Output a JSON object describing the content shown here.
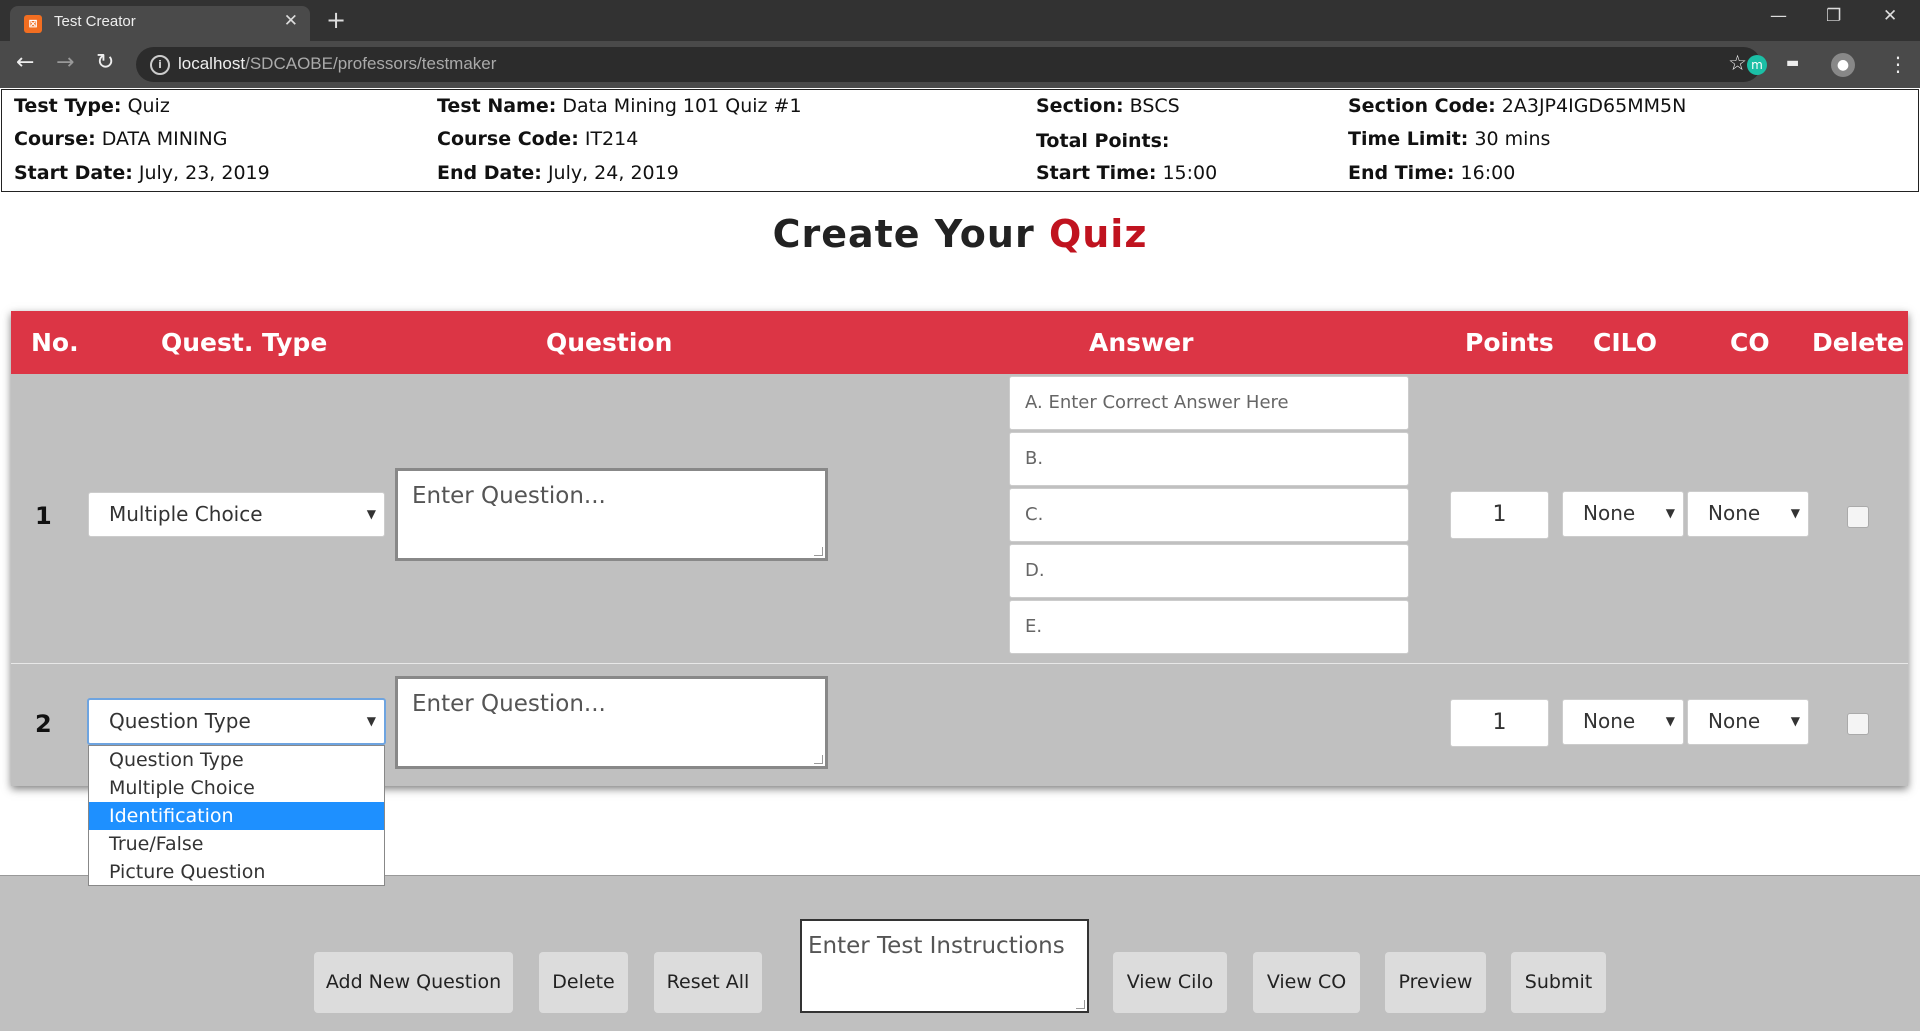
{
  "browser": {
    "tab_title": "Test Creator",
    "tab_icon": "xampp-icon",
    "url_host": "localhost",
    "url_path": "/SDCAOBE/professors/testmaker",
    "extension_m_label": "m"
  },
  "info": {
    "test_type_label": "Test Type:",
    "test_type": "Quiz",
    "course_label": "Course:",
    "course": "DATA MINING",
    "start_date_label": "Start Date:",
    "start_date": "July, 23, 2019",
    "test_name_label": "Test Name:",
    "test_name": "Data Mining 101 Quiz #1",
    "course_code_label": "Course Code:",
    "course_code": "IT214",
    "end_date_label": "End Date:",
    "end_date": "July, 24, 2019",
    "section_label": "Section:",
    "section": "BSCS",
    "total_points_label": "Total Points:",
    "total_points": "",
    "start_time_label": "Start Time:",
    "start_time": "15:00",
    "section_code_label": "Section Code:",
    "section_code": "2A3JP4IGD65MM5N",
    "time_limit_label": "Time Limit:",
    "time_limit": "30 mins",
    "end_time_label": "End Time:",
    "end_time": "16:00"
  },
  "title": {
    "prefix": "Create Your",
    "accent": "Quiz",
    "accent_color": "#c0131f"
  },
  "table": {
    "header_color": "#dc3545",
    "headers": {
      "no": "No.",
      "quest_type": "Quest. Type",
      "question": "Question",
      "answer": "Answer",
      "points": "Points",
      "cilo": "CILO",
      "co": "CO",
      "delete": "Delete"
    },
    "rows": [
      {
        "number": "1",
        "question_type": "Multiple Choice",
        "question_placeholder": "Enter Question...",
        "answers": [
          "A. Enter Correct Answer Here",
          "B.",
          "C.",
          "D.",
          "E."
        ],
        "points": "1",
        "cilo": "None",
        "co": "None"
      },
      {
        "number": "2",
        "question_type": "Question Type",
        "question_placeholder": "Enter Question...",
        "points": "1",
        "cilo": "None",
        "co": "None"
      }
    ]
  },
  "dropdown": {
    "options": [
      "Question Type",
      "Multiple Choice",
      "Identification",
      "True/False",
      "Picture Question"
    ],
    "highlighted": "Identification"
  },
  "footer": {
    "add_new_question": "Add New Question",
    "delete": "Delete",
    "reset_all": "Reset All",
    "instructions_placeholder": "Enter Test Instructions",
    "view_cilo": "View Cilo",
    "view_co": "View CO",
    "preview": "Preview",
    "submit": "Submit"
  }
}
